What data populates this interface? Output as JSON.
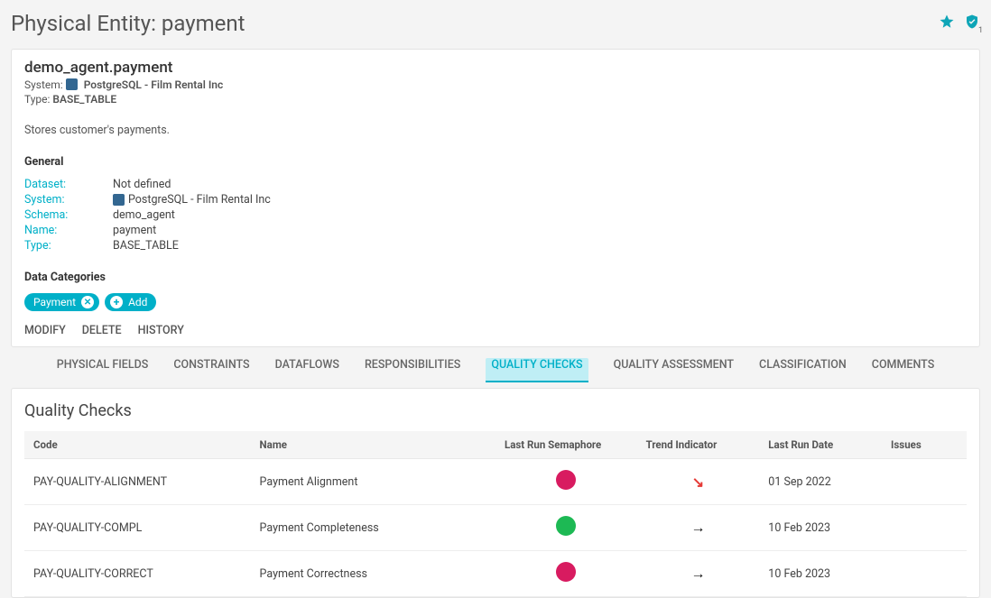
{
  "header": {
    "title": "Physical Entity: payment"
  },
  "entity": {
    "full_name": "demo_agent.payment",
    "system_label": "System:",
    "system_value": "PostgreSQL - Film Rental Inc",
    "type_label": "Type:",
    "type_value": "BASE_TABLE",
    "description": "Stores customer's payments."
  },
  "general": {
    "heading": "General",
    "rows": [
      {
        "label": "Dataset:",
        "value": "Not defined",
        "icon": false
      },
      {
        "label": "System:",
        "value": "PostgreSQL - Film Rental Inc",
        "icon": true
      },
      {
        "label": "Schema:",
        "value": "demo_agent",
        "icon": false
      },
      {
        "label": "Name:",
        "value": "payment",
        "icon": false
      },
      {
        "label": "Type:",
        "value": "BASE_TABLE",
        "icon": false
      }
    ]
  },
  "categories": {
    "heading": "Data Categories",
    "tag": "Payment",
    "add_label": "Add"
  },
  "actions": {
    "modify": "MODIFY",
    "delete": "DELETE",
    "history": "HISTORY"
  },
  "tabs": [
    {
      "label": "PHYSICAL FIELDS",
      "active": false
    },
    {
      "label": "CONSTRAINTS",
      "active": false
    },
    {
      "label": "DATAFLOWS",
      "active": false
    },
    {
      "label": "RESPONSIBILITIES",
      "active": false
    },
    {
      "label": "QUALITY CHECKS",
      "active": true
    },
    {
      "label": "QUALITY ASSESSMENT",
      "active": false
    },
    {
      "label": "CLASSIFICATION",
      "active": false
    },
    {
      "label": "COMMENTS",
      "active": false
    }
  ],
  "quality_checks": {
    "title": "Quality Checks",
    "columns": {
      "code": "Code",
      "name": "Name",
      "semaphore": "Last Run Semaphore",
      "trend": "Trend Indicator",
      "last_run": "Last Run Date",
      "issues": "Issues"
    },
    "rows": [
      {
        "code": "PAY-QUALITY-ALIGNMENT",
        "name": "Payment Alignment",
        "sema": "red",
        "trend": "down",
        "last_run": "01 Sep 2022",
        "issues": ""
      },
      {
        "code": "PAY-QUALITY-COMPL",
        "name": "Payment Completeness",
        "sema": "green",
        "trend": "flat",
        "last_run": "10 Feb 2023",
        "issues": ""
      },
      {
        "code": "PAY-QUALITY-CORRECT",
        "name": "Payment Correctness",
        "sema": "red",
        "trend": "flat",
        "last_run": "10 Feb 2023",
        "issues": ""
      }
    ]
  },
  "shield_badge": "1"
}
